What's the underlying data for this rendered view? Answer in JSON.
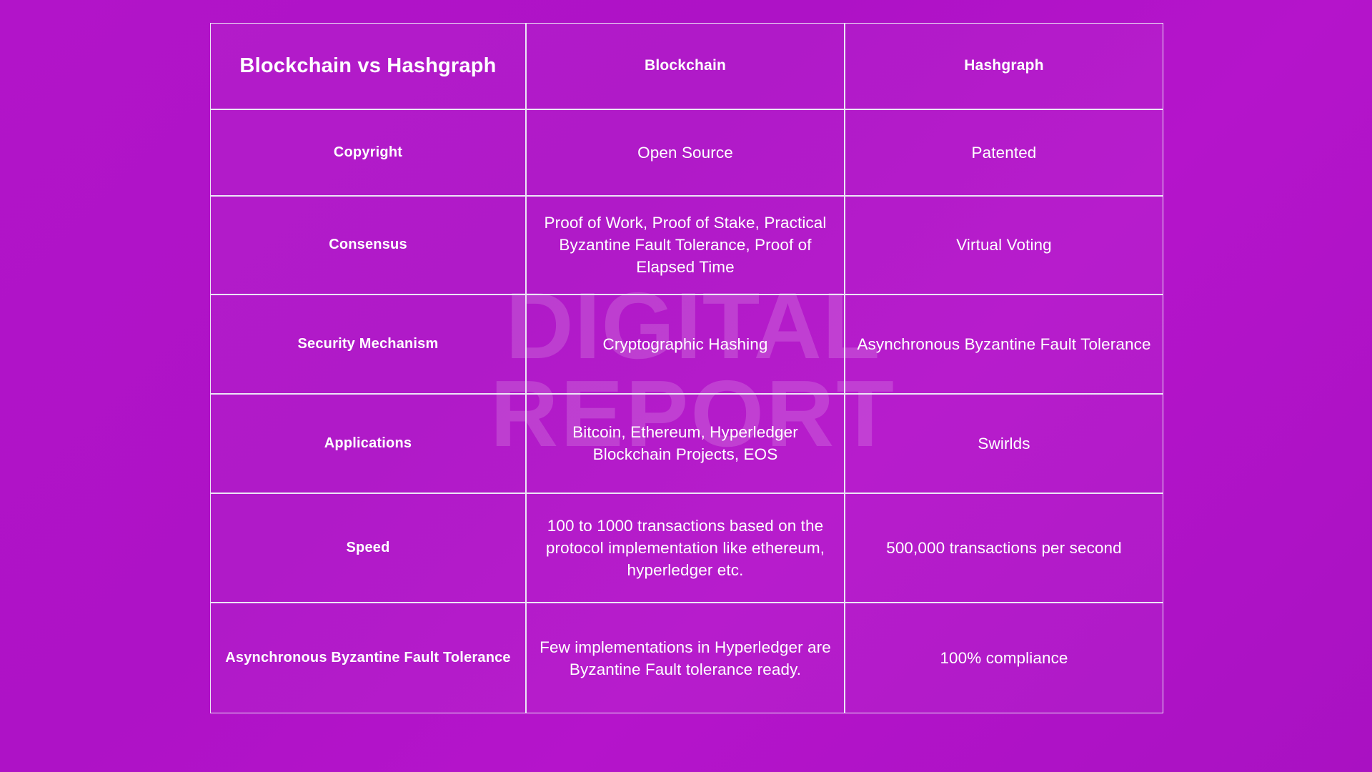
{
  "watermark": {
    "line1": "DIGITAL",
    "line2": "REPORT"
  },
  "table": {
    "title": "Blockchain vs Hashgraph",
    "columns": [
      {
        "key": "label",
        "label": "Blockchain vs Hashgraph"
      },
      {
        "key": "blockchain",
        "label": "Blockchain"
      },
      {
        "key": "hashgraph",
        "label": "Hashgraph"
      }
    ],
    "rows": [
      {
        "label": "Copyright",
        "blockchain": "Open Source",
        "hashgraph": "Patented"
      },
      {
        "label": "Consensus",
        "blockchain": "Proof of Work, Proof of Stake, Practical Byzantine Fault Tolerance, Proof of Elapsed Time",
        "hashgraph": "Virtual Voting"
      },
      {
        "label": "Security Mechanism",
        "blockchain": "Cryptographic Hashing",
        "hashgraph": "Asynchronous Byzantine Fault Tolerance"
      },
      {
        "label": "Applications",
        "blockchain": "Bitcoin, Ethereum, Hyperledger Blockchain Projects, EOS",
        "hashgraph": "Swirlds"
      },
      {
        "label": "Speed",
        "blockchain": "100 to 1000 transactions based on the protocol implementation like ethereum, hyperledger etc.",
        "hashgraph": "500,000 transactions per second"
      },
      {
        "label": "Asynchronous Byzantine Fault Tolerance",
        "blockchain": "Few implementations in Hyperledger are\nByzantine Fault tolerance ready.",
        "hashgraph": "100% compliance"
      }
    ]
  },
  "colors": {
    "background_start": "#b214c9",
    "background_end": "#a911c2",
    "border": "#ece5f6",
    "text": "#ffffff",
    "watermark": "rgba(255,255,255,0.155)"
  }
}
